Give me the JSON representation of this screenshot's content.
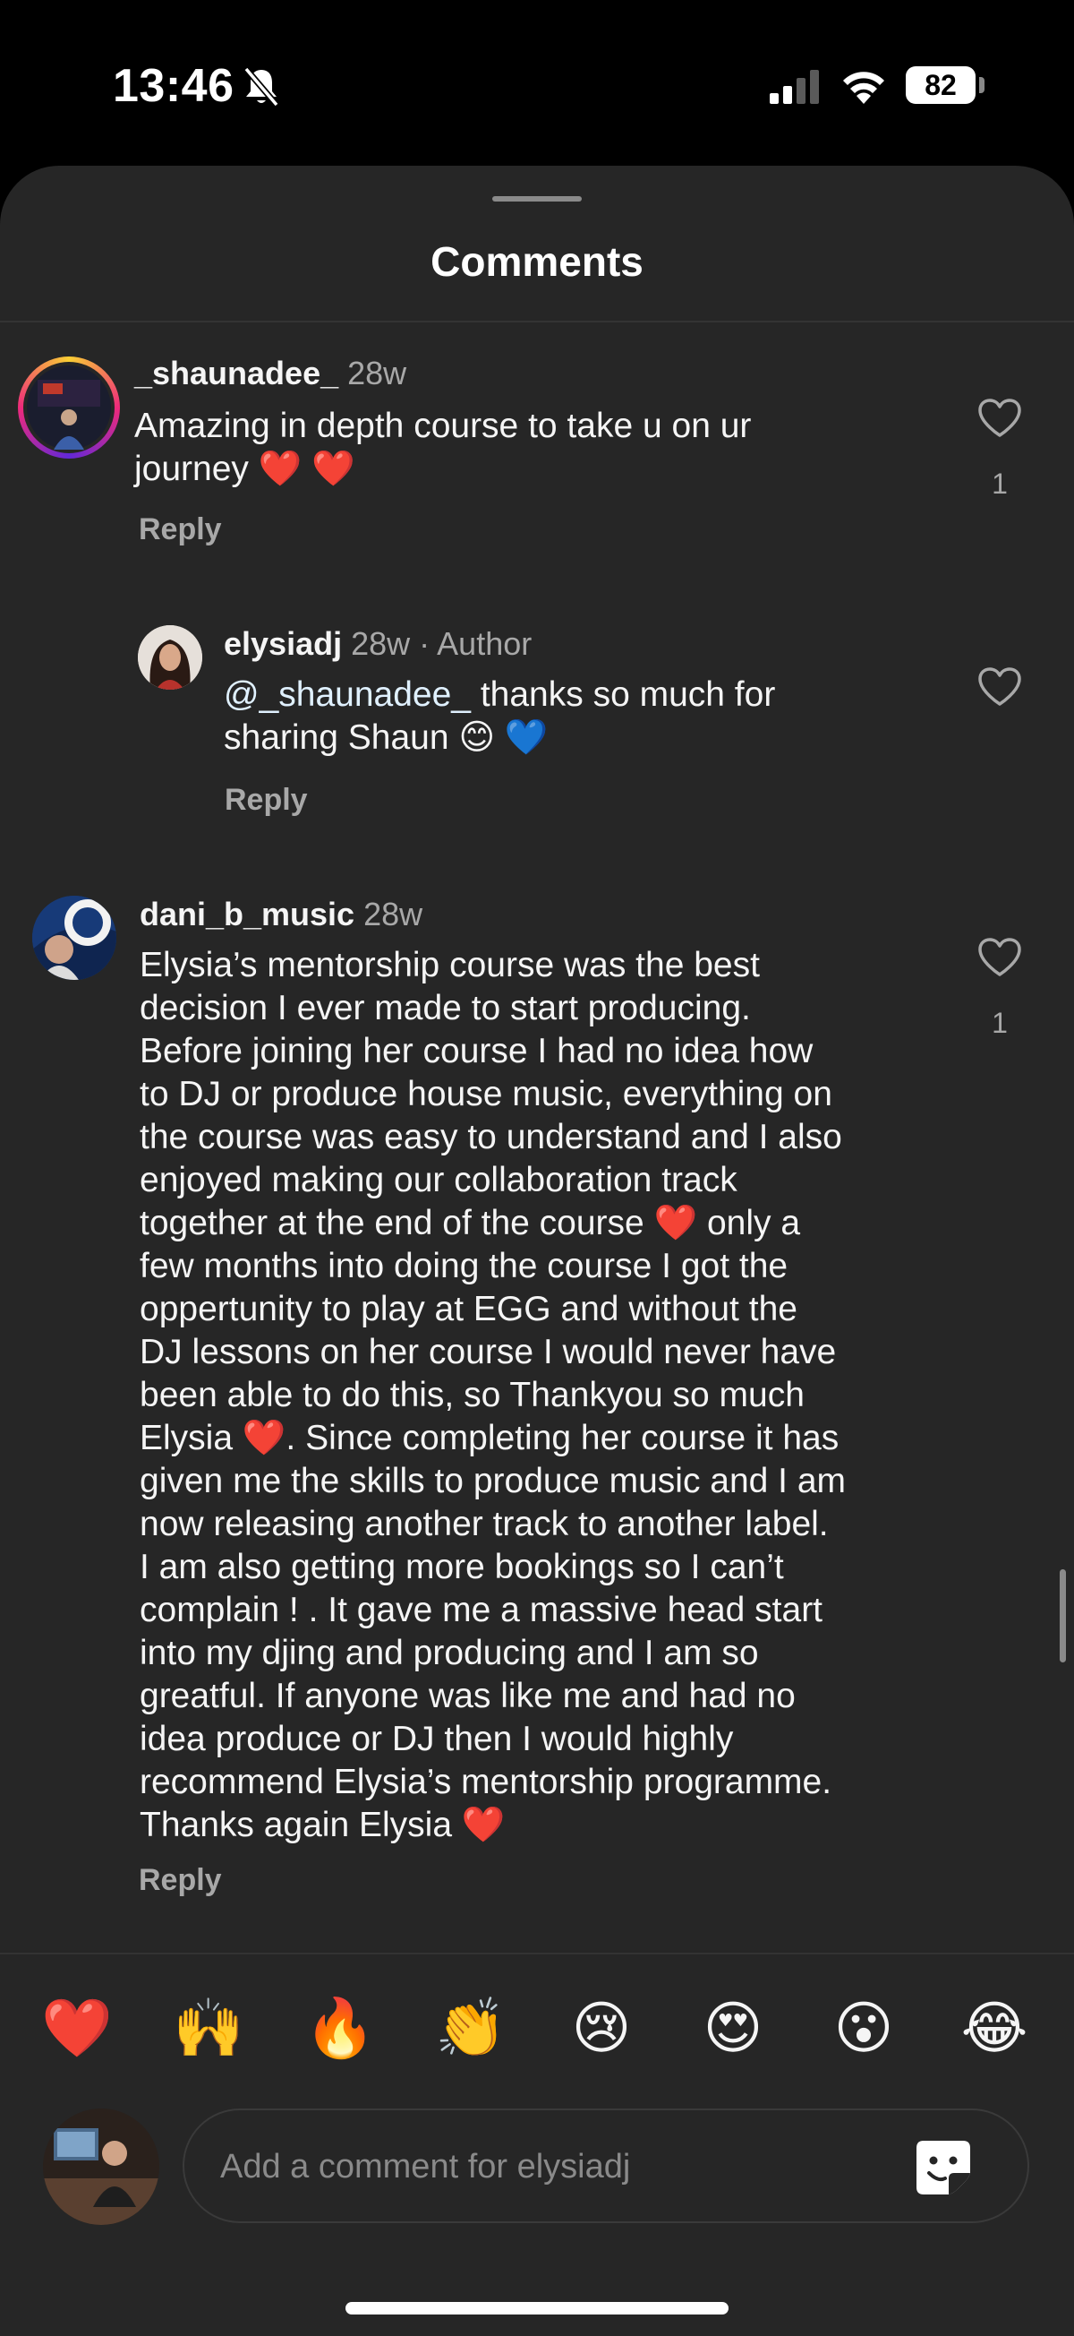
{
  "status_bar": {
    "time": "13:46",
    "battery": "82"
  },
  "sheet": {
    "title": "Comments"
  },
  "comments": [
    {
      "username": "_shaunadee_",
      "time": "28w",
      "text": "Amazing in depth course to take u on ur\njourney ❤️ ❤️",
      "reply_label": "Reply",
      "likes": "1"
    },
    {
      "username": "elysiadj",
      "time": "28w · Author",
      "mention": "@_shaunadee_",
      "text": " thanks so much for\nsharing Shaun 😊 💙",
      "reply_label": "Reply"
    },
    {
      "username": "dani_b_music",
      "time": "28w",
      "text": "Elysia’s mentorship course was the best\ndecision I ever made to start producing.\nBefore joining her course I had no idea how\nto DJ or produce house music, everything on\nthe course was easy to understand and I also\nenjoyed making our collaboration track\ntogether at the end of the course ❤️ only a\nfew months into doing the course I got the\noppertunity to play at EGG and without the\nDJ lessons on her course I would never have\nbeen able to do this, so Thankyou so much\nElysia ❤️. Since completing her course it has\ngiven me the skills to produce music and I am\nnow releasing another track to another label.\nI am also getting more bookings so I can’t\ncomplain ! . It gave me a massive head start\ninto my djing and producing and I am so\ngreatful. If anyone was like me and had no\nidea produce or DJ then I would highly\nrecommend Elysia’s mentorship programme.\nThanks again Elysia ❤️",
      "reply_label": "Reply",
      "likes": "1"
    }
  ],
  "reactions": [
    "❤️",
    "🙌",
    "🔥",
    "👏",
    "😢",
    "😍",
    "😮",
    "😂"
  ],
  "composer": {
    "placeholder": "Add a comment for elysiadj"
  }
}
